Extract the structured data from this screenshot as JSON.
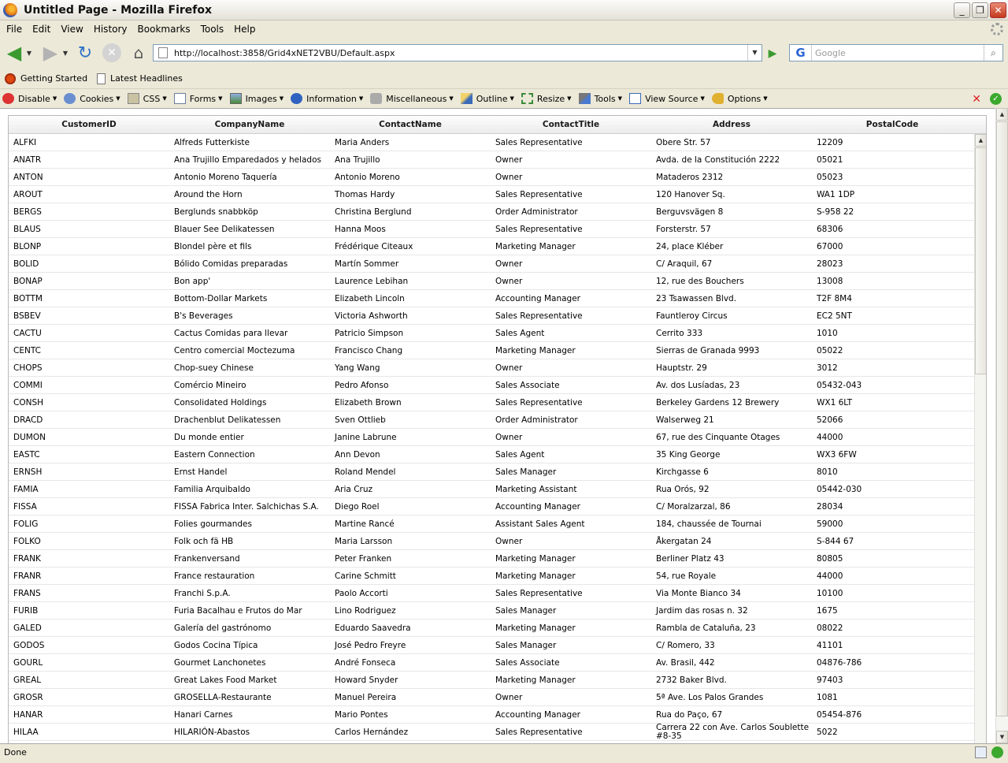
{
  "window": {
    "title": "Untitled Page - Mozilla Firefox"
  },
  "menu": [
    "File",
    "Edit",
    "View",
    "History",
    "Bookmarks",
    "Tools",
    "Help"
  ],
  "nav": {
    "url": "http://localhost:3858/Grid4xNET2VBU/Default.aspx",
    "search_placeholder": "Google"
  },
  "bookmarks": [
    "Getting Started",
    "Latest Headlines"
  ],
  "devbar": [
    "Disable",
    "Cookies",
    "CSS",
    "Forms",
    "Images",
    "Information",
    "Miscellaneous",
    "Outline",
    "Resize",
    "Tools",
    "View Source",
    "Options"
  ],
  "grid": {
    "columns": [
      "CustomerID",
      "CompanyName",
      "ContactName",
      "ContactTitle",
      "Address",
      "PostalCode"
    ],
    "rows": [
      [
        "ALFKI",
        "Alfreds Futterkiste",
        "Maria Anders",
        "Sales Representative",
        "Obere Str. 57",
        "12209"
      ],
      [
        "ANATR",
        "Ana Trujillo Emparedados y helados",
        "Ana Trujillo",
        "Owner",
        "Avda. de la Constitución 2222",
        "05021"
      ],
      [
        "ANTON",
        "Antonio Moreno Taquería",
        "Antonio Moreno",
        "Owner",
        "Mataderos 2312",
        "05023"
      ],
      [
        "AROUT",
        "Around the Horn",
        "Thomas Hardy",
        "Sales Representative",
        "120 Hanover Sq.",
        "WA1 1DP"
      ],
      [
        "BERGS",
        "Berglunds snabbköp",
        "Christina Berglund",
        "Order Administrator",
        "Berguvsvägen 8",
        "S-958 22"
      ],
      [
        "BLAUS",
        "Blauer See Delikatessen",
        "Hanna Moos",
        "Sales Representative",
        "Forsterstr. 57",
        "68306"
      ],
      [
        "BLONP",
        "Blondel père et fils",
        "Frédérique Citeaux",
        "Marketing Manager",
        "24, place Kléber",
        "67000"
      ],
      [
        "BOLID",
        "Bólido Comidas preparadas",
        "Martín Sommer",
        "Owner",
        "C/ Araquil, 67",
        "28023"
      ],
      [
        "BONAP",
        "Bon app'",
        "Laurence Lebihan",
        "Owner",
        "12, rue des Bouchers",
        "13008"
      ],
      [
        "BOTTM",
        "Bottom-Dollar Markets",
        "Elizabeth Lincoln",
        "Accounting Manager",
        "23 Tsawassen Blvd.",
        "T2F 8M4"
      ],
      [
        "BSBEV",
        "B's Beverages",
        "Victoria Ashworth",
        "Sales Representative",
        "Fauntleroy Circus",
        "EC2 5NT"
      ],
      [
        "CACTU",
        "Cactus Comidas para llevar",
        "Patricio Simpson",
        "Sales Agent",
        "Cerrito 333",
        "1010"
      ],
      [
        "CENTC",
        "Centro comercial Moctezuma",
        "Francisco Chang",
        "Marketing Manager",
        "Sierras de Granada 9993",
        "05022"
      ],
      [
        "CHOPS",
        "Chop-suey Chinese",
        "Yang Wang",
        "Owner",
        "Hauptstr. 29",
        "3012"
      ],
      [
        "COMMI",
        "Comércio Mineiro",
        "Pedro Afonso",
        "Sales Associate",
        "Av. dos Lusíadas, 23",
        "05432-043"
      ],
      [
        "CONSH",
        "Consolidated Holdings",
        "Elizabeth Brown",
        "Sales Representative",
        "Berkeley Gardens 12 Brewery",
        "WX1 6LT"
      ],
      [
        "DRACD",
        "Drachenblut Delikatessen",
        "Sven Ottlieb",
        "Order Administrator",
        "Walserweg 21",
        "52066"
      ],
      [
        "DUMON",
        "Du monde entier",
        "Janine Labrune",
        "Owner",
        "67, rue des Cinquante Otages",
        "44000"
      ],
      [
        "EASTC",
        "Eastern Connection",
        "Ann Devon",
        "Sales Agent",
        "35 King George",
        "WX3 6FW"
      ],
      [
        "ERNSH",
        "Ernst Handel",
        "Roland Mendel",
        "Sales Manager",
        "Kirchgasse 6",
        "8010"
      ],
      [
        "FAMIA",
        "Familia Arquibaldo",
        "Aria Cruz",
        "Marketing Assistant",
        "Rua Orós, 92",
        "05442-030"
      ],
      [
        "FISSA",
        "FISSA Fabrica Inter. Salchichas S.A.",
        "Diego Roel",
        "Accounting Manager",
        "C/ Moralzarzal, 86",
        "28034"
      ],
      [
        "FOLIG",
        "Folies gourmandes",
        "Martine Rancé",
        "Assistant Sales Agent",
        "184, chaussée de Tournai",
        "59000"
      ],
      [
        "FOLKO",
        "Folk och fä HB",
        "Maria Larsson",
        "Owner",
        "Åkergatan 24",
        "S-844 67"
      ],
      [
        "FRANK",
        "Frankenversand",
        "Peter Franken",
        "Marketing Manager",
        "Berliner Platz 43",
        "80805"
      ],
      [
        "FRANR",
        "France restauration",
        "Carine Schmitt",
        "Marketing Manager",
        "54, rue Royale",
        "44000"
      ],
      [
        "FRANS",
        "Franchi S.p.A.",
        "Paolo Accorti",
        "Sales Representative",
        "Via Monte Bianco 34",
        "10100"
      ],
      [
        "FURIB",
        "Furia Bacalhau e Frutos do Mar",
        "Lino Rodriguez",
        "Sales Manager",
        "Jardim das rosas n. 32",
        "1675"
      ],
      [
        "GALED",
        "Galería del gastrónomo",
        "Eduardo Saavedra",
        "Marketing Manager",
        "Rambla de Cataluña, 23",
        "08022"
      ],
      [
        "GODOS",
        "Godos Cocina Típica",
        "José Pedro Freyre",
        "Sales Manager",
        "C/ Romero, 33",
        "41101"
      ],
      [
        "GOURL",
        "Gourmet Lanchonetes",
        "André Fonseca",
        "Sales Associate",
        "Av. Brasil, 442",
        "04876-786"
      ],
      [
        "GREAL",
        "Great Lakes Food Market",
        "Howard Snyder",
        "Marketing Manager",
        "2732 Baker Blvd.",
        "97403"
      ],
      [
        "GROSR",
        "GROSELLA-Restaurante",
        "Manuel Pereira",
        "Owner",
        "5ª Ave. Los Palos Grandes",
        "1081"
      ],
      [
        "HANAR",
        "Hanari Carnes",
        "Mario Pontes",
        "Accounting Manager",
        "Rua do Paço, 67",
        "05454-876"
      ],
      [
        "HILAA",
        "HILARIÓN-Abastos",
        "Carlos Hernández",
        "Sales Representative",
        "Carrera 22 con Ave. Carlos Soublette #8-35",
        "5022"
      ]
    ]
  },
  "status": {
    "text": "Done"
  }
}
